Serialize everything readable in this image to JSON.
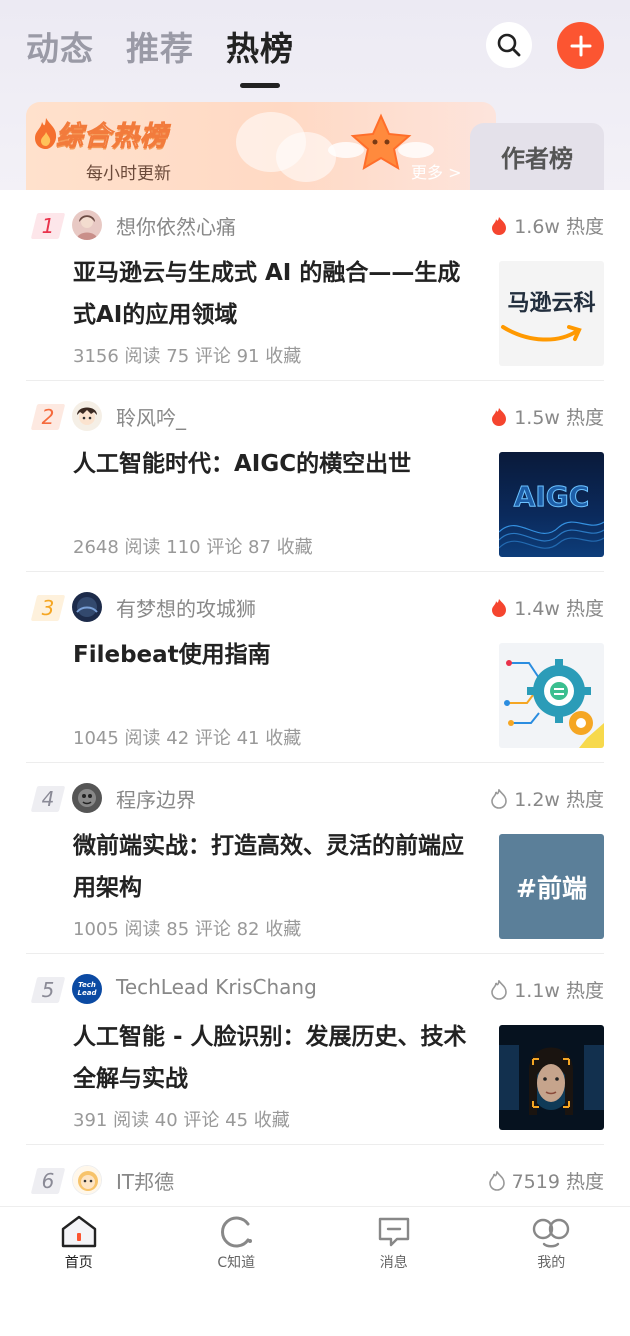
{
  "header": {
    "tabs": [
      {
        "label": "动态",
        "active": false
      },
      {
        "label": "推荐",
        "active": false
      },
      {
        "label": "热榜",
        "active": true
      }
    ],
    "search_icon": "search-icon",
    "add_icon": "plus-icon",
    "accent_color": "#fc5531"
  },
  "banner": {
    "title": "综合热榜",
    "subtitle": "每小时更新",
    "more": "更多 >",
    "author_tab": "作者榜"
  },
  "items": [
    {
      "rank": "1",
      "author": "想你依然心痛",
      "heat": "1.6w 热度",
      "hot": true,
      "title": "亚马逊云与生成式 AI 的融合——生成式AI的应用领域",
      "stats": "3156 阅读 75 评论 91 收藏",
      "thumb_text": "马逊云科"
    },
    {
      "rank": "2",
      "author": "聆风吟_",
      "heat": "1.5w 热度",
      "hot": true,
      "title": "人工智能时代：AIGC的横空出世",
      "stats": "2648 阅读 110 评论 87 收藏",
      "thumb_text": "AIGC"
    },
    {
      "rank": "3",
      "author": "有梦想的攻城狮",
      "heat": "1.4w 热度",
      "hot": true,
      "title": "Filebeat使用指南",
      "stats": "1045 阅读 42 评论 41 收藏",
      "thumb_text": ""
    },
    {
      "rank": "4",
      "author": "程序边界",
      "heat": "1.2w 热度",
      "hot": false,
      "title": "微前端实战：打造高效、灵活的前端应用架构",
      "stats": "1005 阅读 85 评论 82 收藏",
      "thumb_text": "#前端"
    },
    {
      "rank": "5",
      "author": "TechLead KrisChang",
      "heat": "1.1w 热度",
      "hot": false,
      "title": "人工智能 - 人脸识别：发展历史、技术全解与实战",
      "stats": "391 阅读 40 评论 45 收藏",
      "thumb_text": ""
    },
    {
      "rank": "6",
      "author": "IT邦德",
      "heat": "7519 热度",
      "hot": false,
      "title": "",
      "stats": "",
      "thumb_text": ""
    }
  ],
  "avatar_text": {
    "item5": "Tech Lead"
  },
  "rank_colors": [
    "#e9324b",
    "#f56a3c",
    "#f5a623",
    "#8a8a96",
    "#8a8a96",
    "#8a8a96"
  ],
  "bottom_nav": [
    {
      "label": "首页",
      "icon": "home-icon",
      "active": true
    },
    {
      "label": "C知道",
      "icon": "c-know-icon",
      "active": false
    },
    {
      "label": "消息",
      "icon": "message-icon",
      "active": false
    },
    {
      "label": "我的",
      "icon": "profile-icon",
      "active": false
    }
  ]
}
